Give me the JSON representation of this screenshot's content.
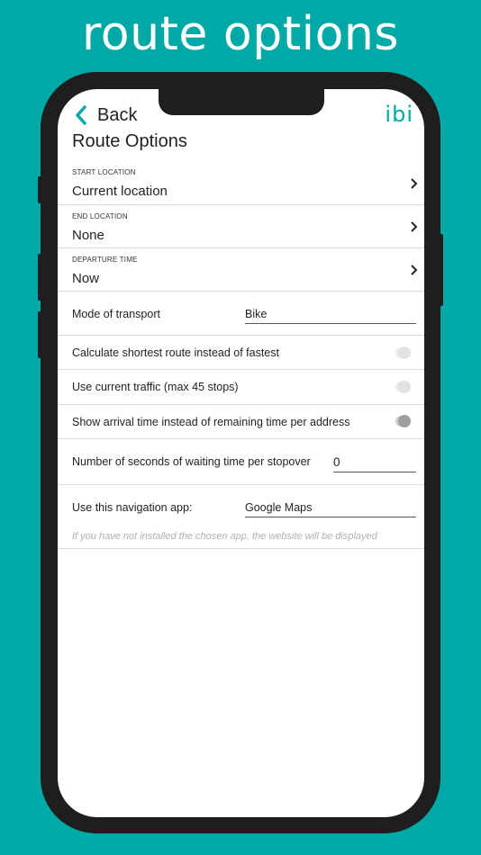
{
  "promo": {
    "headline": "route options"
  },
  "header": {
    "back_label": "Back",
    "logo_text": "ibi",
    "title": "Route Options"
  },
  "start_location": {
    "label": "START LOCATION",
    "value": "Current location"
  },
  "end_location": {
    "label": "END LOCATION",
    "value": "None"
  },
  "departure_time": {
    "label": "DEPARTURE TIME",
    "value": "Now"
  },
  "transport": {
    "label": "Mode of transport",
    "value": "Bike"
  },
  "toggles": [
    {
      "label": "Calculate shortest route instead of fastest",
      "on": false
    },
    {
      "label": "Use current traffic (max 45 stops)",
      "on": false
    },
    {
      "label": "Show arrival time instead of remaining time per address",
      "on": true
    }
  ],
  "waiting": {
    "label": "Number of seconds of waiting time per stopover",
    "value": "0"
  },
  "navigation_app": {
    "label": "Use this navigation app:",
    "value": "Google Maps",
    "note": "If you have not installed the chosen app, the website will be displayed"
  },
  "colors": {
    "accent": "#00a9a5",
    "toggle_off_track": "#ececec",
    "toggle_off_knob": "#e2e2e2",
    "toggle_on_track": "#cfcfcf",
    "toggle_on_knob": "#9e9e9e"
  }
}
